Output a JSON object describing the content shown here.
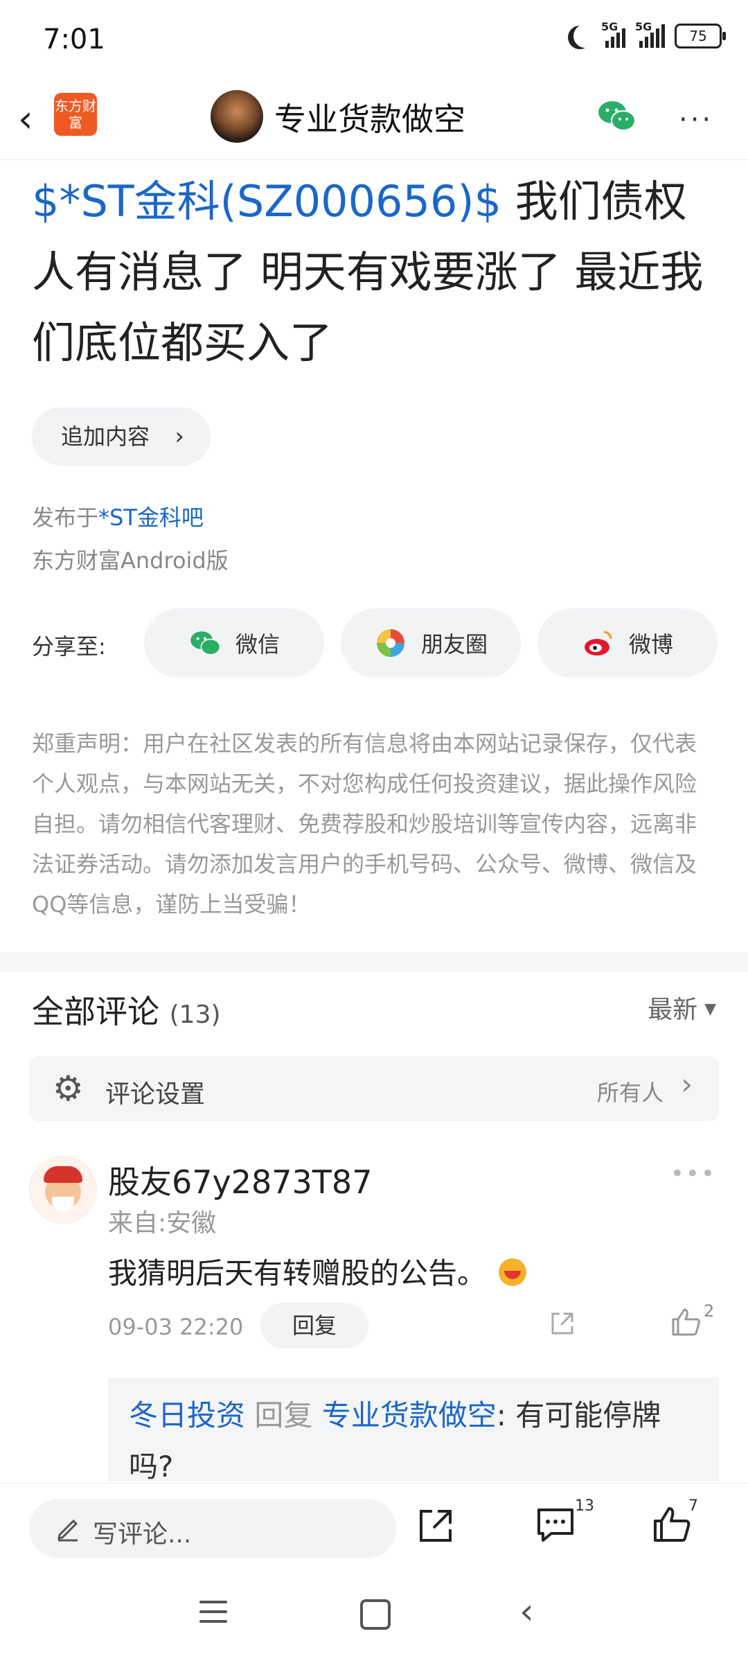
{
  "status_bar": {
    "time": "7:01",
    "network1": "5G",
    "network2": "5G",
    "battery": "75"
  },
  "nav": {
    "back_icon": "chevron-left-icon",
    "app_logo_text": "东方财富",
    "title": "专业货款做空",
    "more_label": "···"
  },
  "post": {
    "stock_tag": "$*ST金科(SZ000656)$",
    "text": " 我们债权人有消息了 明天有戏要涨了 最近我们底位都买入了",
    "append_label": "追加内容",
    "append_chev": "›",
    "published_prefix": "发布于",
    "forum_link": "*ST金科吧",
    "client": "东方财富Android版"
  },
  "share": {
    "label": "分享至:",
    "wechat": "微信",
    "moments": "朋友圈",
    "weibo": "微博"
  },
  "disclaimer": "郑重声明：用户在社区发表的所有信息将由本网站记录保存，仅代表个人观点，与本网站无关，不对您构成任何投资建议，据此操作风险自担。请勿相信代客理财、免费荐股和炒股培训等宣传内容，远离非法证券活动。请勿添加发言用户的手机号码、公众号、微博、微信及QQ等信息，谨防上当受骗！",
  "comments": {
    "title": "全部评论",
    "count": "(13)",
    "sort_label": "最新",
    "settings_label": "评论设置",
    "settings_value": "所有人",
    "settings_chev": "›",
    "items": [
      {
        "user": "股友67y2873T87",
        "location": "来自:安徽",
        "text": "我猜明后天有转赠股的公告。",
        "date": "09-03 22:20",
        "reply_label": "回复",
        "like_count": "2",
        "replies": [
          {
            "from": "冬日投资",
            "verb": "回复",
            "to": "专业货款做空",
            "text": ": 有可能停牌吗?"
          }
        ]
      }
    ]
  },
  "bottom_bar": {
    "write_placeholder": "写评论...",
    "comment_count": "13",
    "like_count": "7"
  },
  "colors": {
    "link_blue": "#1b67c7",
    "wechat_green": "#2aae67",
    "weibo_red": "#e6162d",
    "logo_orange": "#ee5a24"
  }
}
